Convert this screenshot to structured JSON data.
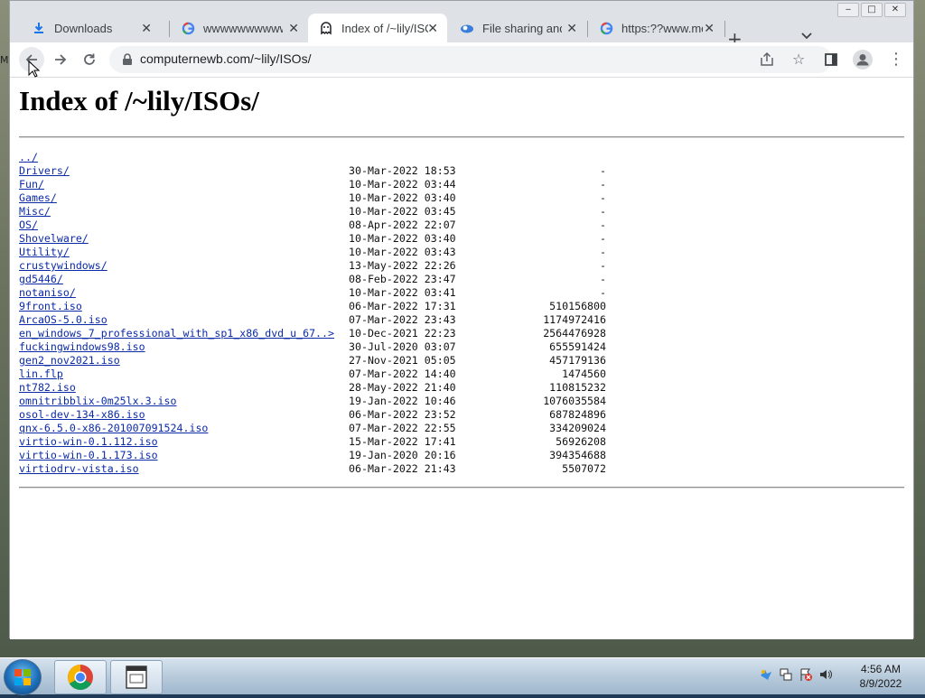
{
  "window_controls": {
    "minimize": "‒",
    "maximize": "□",
    "close": "✕"
  },
  "tabs": [
    {
      "title": "Downloads",
      "icon": "download-icon"
    },
    {
      "title": "wwwwwwwwwwwwwww",
      "icon": "google-icon"
    },
    {
      "title": "Index of /~lily/ISOs/",
      "icon": "ghost-icon",
      "active": true
    },
    {
      "title": "File sharing and c",
      "icon": "cloud-icon"
    },
    {
      "title": "https:??www.me",
      "icon": "google-icon"
    }
  ],
  "new_tab_label": "+",
  "tab_search_label": "⌄",
  "toolbar": {
    "url": "computernewb.com/~lily/ISOs/"
  },
  "page": {
    "title": "Index of /~lily/ISOs/",
    "entries": [
      {
        "name": "../",
        "date": "",
        "size": ""
      },
      {
        "name": "Drivers/",
        "date": "30-Mar-2022 18:53",
        "size": "-"
      },
      {
        "name": "Fun/",
        "date": "10-Mar-2022 03:44",
        "size": "-"
      },
      {
        "name": "Games/",
        "date": "10-Mar-2022 03:40",
        "size": "-"
      },
      {
        "name": "Misc/",
        "date": "10-Mar-2022 03:45",
        "size": "-"
      },
      {
        "name": "OS/",
        "date": "08-Apr-2022 22:07",
        "size": "-"
      },
      {
        "name": "Shovelware/",
        "date": "10-Mar-2022 03:40",
        "size": "-"
      },
      {
        "name": "Utility/",
        "date": "10-Mar-2022 03:43",
        "size": "-"
      },
      {
        "name": "crustywindows/",
        "date": "13-May-2022 22:26",
        "size": "-"
      },
      {
        "name": "gd5446/",
        "date": "08-Feb-2022 23:47",
        "size": "-"
      },
      {
        "name": "notaniso/",
        "date": "10-Mar-2022 03:41",
        "size": "-"
      },
      {
        "name": "9front.iso",
        "date": "06-Mar-2022 17:31",
        "size": "510156800"
      },
      {
        "name": "ArcaOS-5.0.iso",
        "date": "07-Mar-2022 23:43",
        "size": "1174972416"
      },
      {
        "name": "en_windows_7_professional_with_sp1_x86_dvd_u_67..>",
        "date": "10-Dec-2021 22:23",
        "size": "2564476928"
      },
      {
        "name": "fuckingwindows98.iso",
        "date": "30-Jul-2020 03:07",
        "size": "655591424"
      },
      {
        "name": "gen2_nov2021.iso",
        "date": "27-Nov-2021 05:05",
        "size": "457179136"
      },
      {
        "name": "lin.flp",
        "date": "07-Mar-2022 14:40",
        "size": "1474560"
      },
      {
        "name": "nt782.iso",
        "date": "28-May-2022 21:40",
        "size": "110815232"
      },
      {
        "name": "omnitribblix-0m25lx.3.iso",
        "date": "19-Jan-2022 10:46",
        "size": "1076035584"
      },
      {
        "name": "osol-dev-134-x86.iso",
        "date": "06-Mar-2022 23:52",
        "size": "687824896"
      },
      {
        "name": "qnx-6.5.0-x86-201007091524.iso",
        "date": "07-Mar-2022 22:55",
        "size": "334209024"
      },
      {
        "name": "virtio-win-0.1.112.iso",
        "date": "15-Mar-2022 17:41",
        "size": "56926208"
      },
      {
        "name": "virtio-win-0.1.173.iso",
        "date": "19-Jan-2020 20:16",
        "size": "394354688"
      },
      {
        "name": "virtiodrv-vista.iso",
        "date": "06-Mar-2022 21:43",
        "size": "5507072"
      }
    ]
  },
  "taskbar": {
    "apps": [
      {
        "name": "chrome",
        "icon": "chrome-icon"
      },
      {
        "name": "explorer",
        "icon": "app-window-icon"
      }
    ],
    "clock": {
      "time": "4:56 AM",
      "date": "8/9/2022"
    }
  },
  "desktop_fragment": "M",
  "colors": {
    "link": "#0b2aa8",
    "tab_active": "#ffffff",
    "tab_strip": "#dee1e6"
  }
}
